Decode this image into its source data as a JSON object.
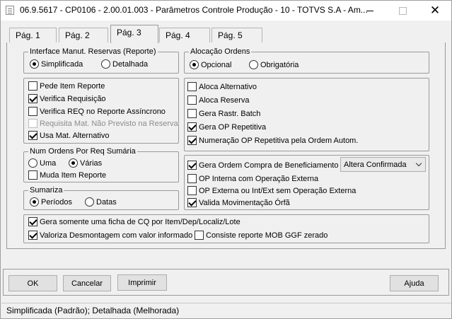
{
  "window": {
    "title": "06.9.5617 - CP0106 - 2.00.01.003 - Parâmetros Controle Produção - 10 - TOTVS S.A - Am...",
    "close_glyph": "✕"
  },
  "tabs": [
    {
      "label": "Pág. 1"
    },
    {
      "label": "Pág. 2"
    },
    {
      "label": "Pág. 3",
      "active": true
    },
    {
      "label": "Pág. 4"
    },
    {
      "label": "Pág. 5"
    }
  ],
  "interface_group": {
    "title": "Interface Manut. Reservas (Reporte)",
    "options": [
      {
        "label": "Simplificada",
        "selected": true
      },
      {
        "label": "Detalhada",
        "selected": false
      }
    ]
  },
  "alocacao_group": {
    "title": "Alocação Ordens",
    "options": [
      {
        "label": "Opcional",
        "selected": true
      },
      {
        "label": "Obrigatória",
        "selected": false
      }
    ]
  },
  "left_checks": [
    {
      "label": "Pede Item Reporte",
      "checked": false,
      "enabled": true
    },
    {
      "label": "Verifica Requisição",
      "checked": true,
      "enabled": true
    },
    {
      "label": "Verifica REQ no Reporte Assíncrono",
      "checked": false,
      "enabled": true
    },
    {
      "label": "Requisita Mat. Não Previsto na Reserva",
      "checked": false,
      "enabled": false
    },
    {
      "label": "Usa Mat. Alternativo",
      "checked": true,
      "enabled": true
    }
  ],
  "right_checks": [
    {
      "label": "Aloca Alternativo",
      "checked": false
    },
    {
      "label": "Aloca Reserva",
      "checked": false
    },
    {
      "label": "Gera Rastr. Batch",
      "checked": false
    },
    {
      "label": "Gera OP Repetitiva",
      "checked": true
    },
    {
      "label": "Numeração OP Repetitiva pela Ordem Autom.",
      "checked": true
    }
  ],
  "num_ordens_group": {
    "title": "Num Ordens Por Req Sumária",
    "options": [
      {
        "label": "Uma",
        "selected": false
      },
      {
        "label": "Várias",
        "selected": true
      }
    ],
    "muda_item": {
      "label": "Muda Item Reporte",
      "checked": false
    }
  },
  "sumariza_group": {
    "title": "Sumariza",
    "options": [
      {
        "label": "Períodos",
        "selected": true
      },
      {
        "label": "Datas",
        "selected": false
      }
    ]
  },
  "beneficiamento_checks": [
    {
      "label": "Gera Ordem Compra de Beneficiamento",
      "checked": true
    },
    {
      "label": "OP Interna com Operação Externa",
      "checked": false
    },
    {
      "label": "OP Externa ou Int/Ext sem Operação Externa",
      "checked": false
    },
    {
      "label": "Valida Movimentação Órfã",
      "checked": true
    }
  ],
  "beneficiamento_select": {
    "value": "Altera Confirmada"
  },
  "bottom_checks": [
    {
      "label": "Gera somente uma ficha de CQ por Item/Dep/Localiz/Lote",
      "checked": true
    },
    {
      "label": "Valoriza Desmontagem com valor informado",
      "checked": true
    },
    {
      "label": "Consiste reporte MOB GGF zerado",
      "checked": false
    }
  ],
  "buttons": {
    "ok": "OK",
    "cancel": "Cancelar",
    "print": "Imprimir",
    "help": "Ajuda"
  },
  "status_text": "Simplificada (Padrão); Detalhada (Melhorada)"
}
